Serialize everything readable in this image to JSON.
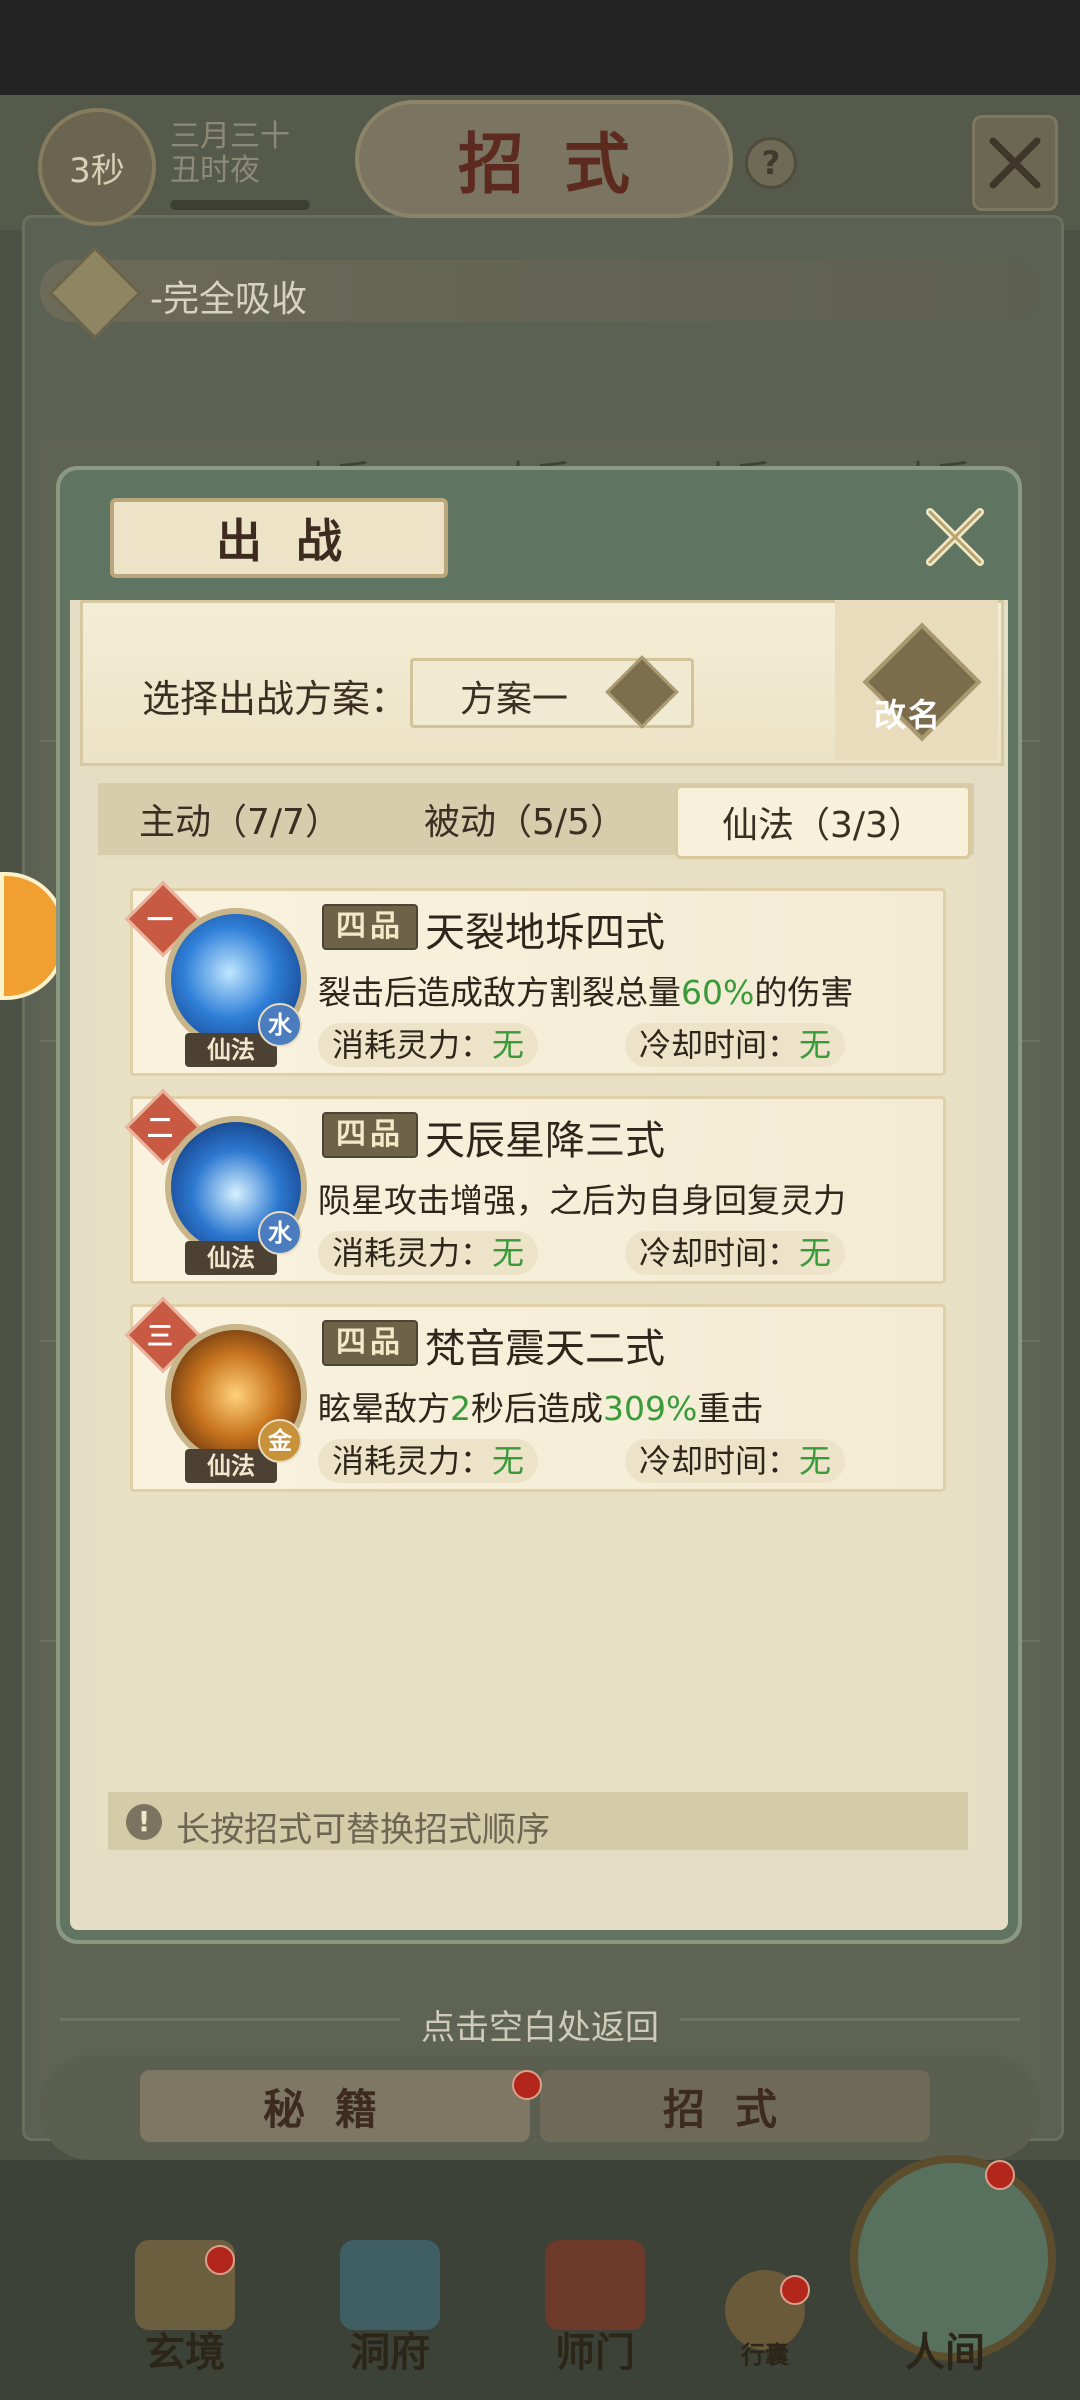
{
  "header": {
    "timer": "3秒",
    "date_line1": "三月三十",
    "date_line2": "丑时夜",
    "title": "招式",
    "help_icon": "question-icon",
    "close_icon": "close-icon"
  },
  "absorb_bar": {
    "label": "-完全吸收"
  },
  "background_tabs": [
    "木系",
    "水系",
    "火系",
    "土系"
  ],
  "modal": {
    "title": "出战",
    "scheme_label": "选择出战方案：",
    "scheme_value": "方案一",
    "rename_label": "改名",
    "tabs": [
      {
        "label": "主动（7/7）",
        "active": false
      },
      {
        "label": "被动（5/5）",
        "active": false
      },
      {
        "label": "仙法（3/3）",
        "active": true
      }
    ],
    "skills": [
      {
        "order": "一",
        "grade": "四品",
        "name": "天裂地坼四式",
        "desc_pre": "裂击后造成敌方割裂总量",
        "desc_hl": "60%",
        "desc_post": "的伤害",
        "tag": "仙法",
        "element": "水",
        "cost_label": "消耗灵力：",
        "cost_value": "无",
        "cooldown_label": "冷却时间：",
        "cooldown_value": "无",
        "icon_color": "#2f7fd8"
      },
      {
        "order": "二",
        "grade": "四品",
        "name": "天辰星降三式",
        "desc_pre": "陨星攻击增强，之后为自身回复灵力",
        "desc_hl": "",
        "desc_post": "",
        "tag": "仙法",
        "element": "水",
        "cost_label": "消耗灵力：",
        "cost_value": "无",
        "cooldown_label": "冷却时间：",
        "cooldown_value": "无",
        "icon_color": "#2c78d0"
      },
      {
        "order": "三",
        "grade": "四品",
        "name": "梵音震天二式",
        "desc_pre": "眩晕敌方",
        "desc_hl": "2",
        "desc_mid": "秒后造成",
        "desc_hl2": "309%",
        "desc_post": "重击",
        "tag": "仙法",
        "element": "金",
        "cost_label": "消耗灵力：",
        "cost_value": "无",
        "cooldown_label": "冷却时间：",
        "cooldown_value": "无",
        "icon_color": "#c8741e"
      }
    ],
    "hint": "长按招式可替换招式顺序"
  },
  "return_hint": "点击空白处返回",
  "bottom_tabs": {
    "left": "秘籍",
    "right": "招式"
  },
  "nav": [
    "玄境",
    "洞府",
    "师门",
    "行囊",
    "人间"
  ],
  "colors": {
    "accent_green": "#3a9a3a",
    "modal_frame": "#5f7561",
    "order_badge": "#c85a44",
    "water_element": "#4c7cc0",
    "gold_element": "#c8923a"
  }
}
